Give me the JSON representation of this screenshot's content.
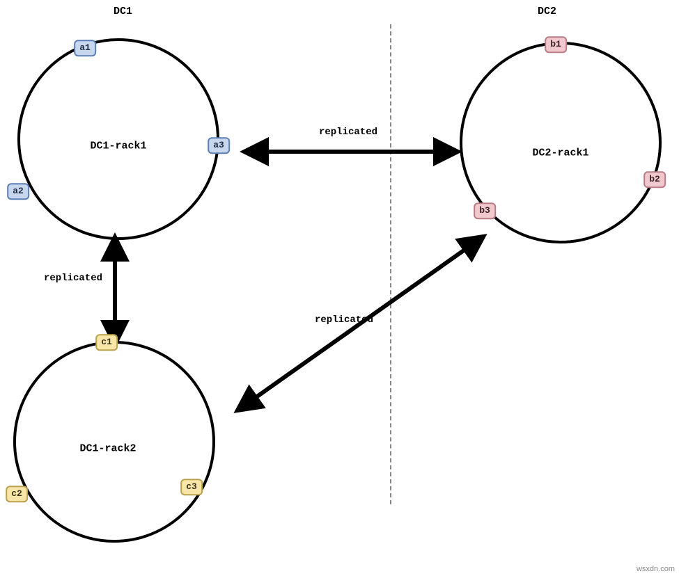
{
  "datacenters": {
    "dc1": {
      "label": "DC1"
    },
    "dc2": {
      "label": "DC2"
    }
  },
  "rings": {
    "dc1_rack1": {
      "label": "DC1-rack1",
      "nodes": {
        "a1": "a1",
        "a2": "a2",
        "a3": "a3"
      },
      "color": "blue"
    },
    "dc1_rack2": {
      "label": "DC1-rack2",
      "nodes": {
        "c1": "c1",
        "c2": "c2",
        "c3": "c3"
      },
      "color": "yellow"
    },
    "dc2_rack1": {
      "label": "DC2-rack1",
      "nodes": {
        "b1": "b1",
        "b2": "b2",
        "b3": "b3"
      },
      "color": "pink"
    }
  },
  "replication": {
    "r1": {
      "label": "replicated",
      "from": "dc1_rack1",
      "to": "dc2_rack1"
    },
    "r2": {
      "label": "replicated",
      "from": "dc1_rack1",
      "to": "dc1_rack2"
    },
    "r3": {
      "label": "replicated",
      "from": "dc1_rack2",
      "to": "dc2_rack1"
    }
  },
  "watermark": "wsxdn.com"
}
